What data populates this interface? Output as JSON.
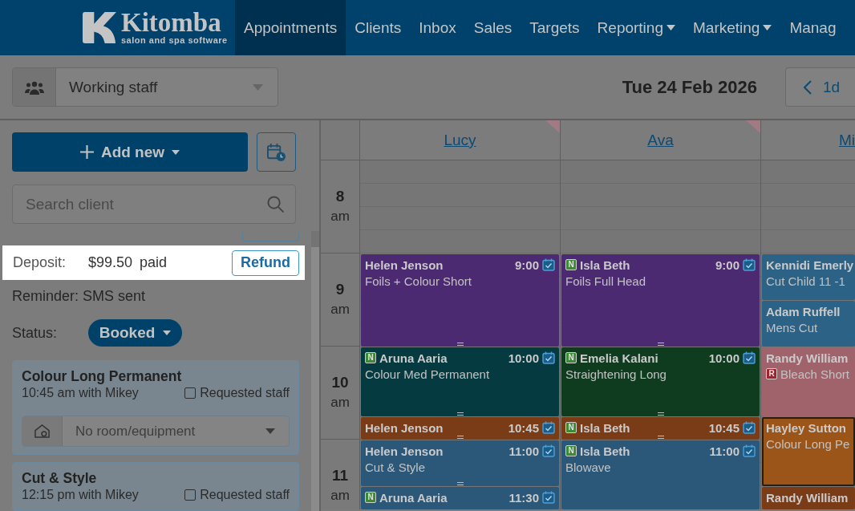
{
  "nav": {
    "logo": {
      "name": "Kitomba",
      "tagline": "salon and spa software"
    },
    "items": [
      {
        "label": "Appointments",
        "selected": true,
        "has_menu": false
      },
      {
        "label": "Clients",
        "selected": false,
        "has_menu": false
      },
      {
        "label": "Inbox",
        "selected": false,
        "has_menu": false
      },
      {
        "label": "Sales",
        "selected": false,
        "has_menu": false
      },
      {
        "label": "Targets",
        "selected": false,
        "has_menu": false
      },
      {
        "label": "Reporting",
        "selected": false,
        "has_menu": true
      },
      {
        "label": "Marketing",
        "selected": false,
        "has_menu": true
      },
      {
        "label": "Manag",
        "selected": false,
        "has_menu": false
      }
    ]
  },
  "toolbar": {
    "staff_filter": {
      "value": "Working staff"
    },
    "date": "Tue 24 Feb 2026",
    "step_back": {
      "label": "1d"
    }
  },
  "sidebar": {
    "add_new": {
      "label": "Add new"
    },
    "search": {
      "placeholder": "Search client"
    },
    "deposit": {
      "label": "Deposit:",
      "amount": "$99.50",
      "state": "paid",
      "action": "Refund",
      "highlighted": true
    },
    "reminder": "Reminder: SMS sent",
    "status": {
      "label": "Status:",
      "value": "Booked"
    },
    "services": [
      {
        "name": "Colour Long Permanent",
        "detail": "10:45 am with Mikey",
        "requested_staff": {
          "label": "Requested staff",
          "checked": false
        },
        "room": {
          "value": "No room/equipment"
        }
      },
      {
        "name": "Cut & Style",
        "detail": "12:15 pm with Mikey",
        "requested_staff": {
          "label": "Requested staff",
          "checked": false
        }
      }
    ]
  },
  "calendar": {
    "hours": [
      {
        "hour": "8",
        "period": "am"
      },
      {
        "hour": "9",
        "period": "am"
      },
      {
        "hour": "10",
        "period": "am"
      },
      {
        "hour": "11",
        "period": "am"
      }
    ],
    "columns": [
      {
        "staff": "Lucy",
        "flagged": true,
        "appointments": [
          {
            "client": "Helen Jenson",
            "time": "9:00",
            "service": "Foils + Colour Short",
            "confirmed": true,
            "resizable": true,
            "selected": false,
            "color": "#4b2a72"
          },
          {
            "client": "Aruna Aaria",
            "client_badge": {
              "letter": "N",
              "color": "#3d8a35"
            },
            "time": "10:00",
            "service": "Colour Med Permanent",
            "confirmed": true,
            "resizable": true,
            "selected": false,
            "color": "#053a40"
          },
          {
            "client": "Helen Jenson",
            "time": "10:45",
            "confirmed": true,
            "resizable": true,
            "selected": false,
            "color": "#7a3c17"
          },
          {
            "client": "Helen Jenson",
            "time": "11:00",
            "service": "Cut & Style",
            "confirmed": true,
            "resizable": true,
            "selected": false,
            "color": "#2b5879"
          },
          {
            "client": "Aruna Aaria",
            "client_badge": {
              "letter": "N",
              "color": "#3d8a35"
            },
            "time": "11:30",
            "confirmed": true,
            "resizable": false,
            "selected": false,
            "color": "#2b5879"
          }
        ]
      },
      {
        "staff": "Ava",
        "flagged": true,
        "appointments": [
          {
            "client": "Isla Beth",
            "client_badge": {
              "letter": "N",
              "color": "#3d8a35"
            },
            "time": "9:00",
            "service": "Foils Full Head",
            "confirmed": true,
            "resizable": true,
            "selected": false,
            "color": "#4b2a72"
          },
          {
            "client": "Emelia Kalani",
            "client_badge": {
              "letter": "N",
              "color": "#3d8a35"
            },
            "time": "10:00",
            "service": "Straightening Long",
            "confirmed": true,
            "resizable": true,
            "selected": false,
            "color": "#0f3c1f"
          },
          {
            "client": "Isla Beth",
            "client_badge": {
              "letter": "N",
              "color": "#3d8a35"
            },
            "time": "10:45",
            "confirmed": true,
            "resizable": true,
            "selected": false,
            "color": "#7a3c17"
          },
          {
            "client": "Isla Beth",
            "client_badge": {
              "letter": "N",
              "color": "#3d8a35"
            },
            "time": "11:00",
            "service": "Blowave",
            "confirmed": true,
            "resizable": false,
            "selected": false,
            "color": "#2b5879"
          }
        ]
      },
      {
        "staff": "Mi",
        "flagged": false,
        "appointments": [
          {
            "client": "Kennidi Emerly",
            "service": "Cut Child 11 -1",
            "resizable": false,
            "selected": false,
            "color": "#2c6285"
          },
          {
            "client": "Adam Ruffell",
            "service": "Mens Cut",
            "resizable": false,
            "selected": false,
            "color": "#2c6285"
          },
          {
            "client": "Randy William",
            "service": "Bleach Short",
            "service_badge": {
              "letter": "R",
              "color": "#a3222c"
            },
            "resizable": false,
            "selected": false,
            "color": "#a0636b"
          },
          {
            "client": "Hayley Sutton",
            "service": "Colour Long Pe",
            "resizable": false,
            "selected": true,
            "color": "#9c5519"
          },
          {
            "client": "Randy William",
            "resizable": false,
            "selected": false,
            "color": "#7a3c17"
          }
        ]
      }
    ]
  }
}
